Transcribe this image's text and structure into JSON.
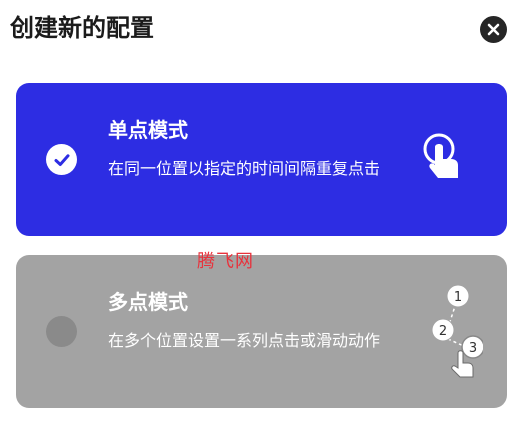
{
  "dialog": {
    "title": "创建新的配置",
    "close_icon": "close-icon"
  },
  "modes": [
    {
      "title": "单点模式",
      "description": "在同一位置以指定的时间间隔重复点击",
      "selected": true,
      "color": "#2d2de3",
      "icon": "single-tap-icon"
    },
    {
      "title": "多点模式",
      "description": "在多个位置设置一系列点击或滑动动作",
      "selected": false,
      "color": "#a3a3a3",
      "icon": "multi-tap-icon",
      "steps": [
        "1",
        "2",
        "3"
      ]
    }
  ],
  "watermark": "腾飞网"
}
